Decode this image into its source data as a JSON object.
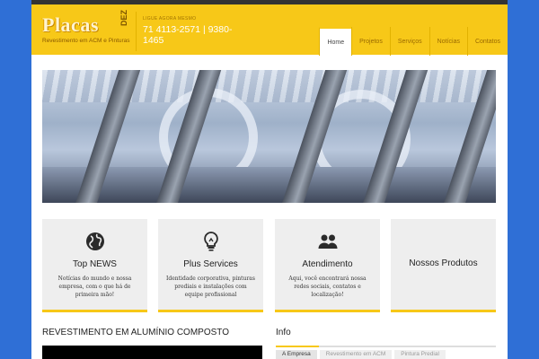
{
  "header": {
    "logo": {
      "word": "Placas",
      "badge": "DEZ",
      "subtitle": "Revestimento em ACM e Pinturas"
    },
    "contact": {
      "label": "Ligue agora mesmo",
      "phone": "71 4113-2571 | 9380-1465"
    },
    "nav": [
      {
        "label": "Home",
        "active": true
      },
      {
        "label": "Projetos",
        "active": false
      },
      {
        "label": "Serviços",
        "active": false
      },
      {
        "label": "Notícias",
        "active": false
      },
      {
        "label": "Contatos",
        "active": false
      }
    ]
  },
  "features": [
    {
      "icon": "globe-icon",
      "title": "Top NEWS",
      "text": "Notícias do mundo e nossa empresa, com o que há de primeira mão!"
    },
    {
      "icon": "lightbulb-icon",
      "title": "Plus Services",
      "text": "Identidade corporativa, pinturas prediais e instalações com equipe profissional"
    },
    {
      "icon": "users-icon",
      "title": "Atendimento",
      "text": "Aqui, você encontrará nossa redes sociais, contatos e localização!"
    },
    {
      "icon": "",
      "title": "Nossos Produtos",
      "text": ""
    }
  ],
  "sections": {
    "main_title": "REVESTIMENTO EM ALUMÍNIO COMPOSTO",
    "info_title": "Info",
    "info_tabs": [
      {
        "label": "A Empresa",
        "active": true
      },
      {
        "label": "Revestimento em ACM",
        "active": false
      },
      {
        "label": "Pintura Predial",
        "active": false
      }
    ]
  },
  "colors": {
    "accent": "#f7c818",
    "background": "#2f6fd6",
    "topbar": "#333333"
  }
}
